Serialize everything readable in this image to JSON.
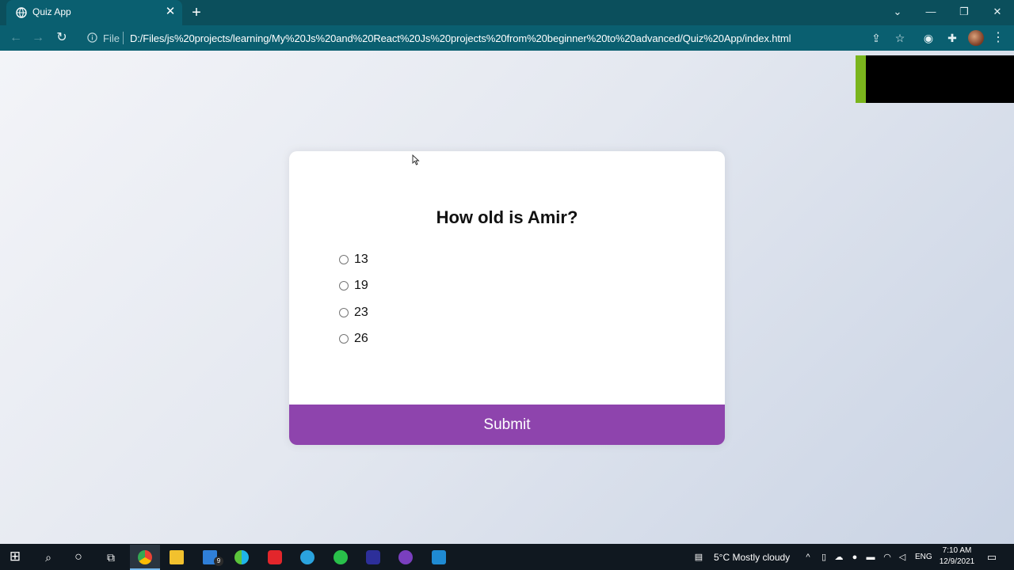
{
  "browser": {
    "tab_title": "Quiz App",
    "url_scheme": "File",
    "url": "D:/Files/js%20projects/learning/My%20Js%20and%20React%20Js%20projects%20from%20beginner%20to%20advanced/Quiz%20App/index.html"
  },
  "quiz": {
    "question": "How old is Amir?",
    "answers": [
      "13",
      "19",
      "23",
      "26"
    ],
    "submit_label": "Submit"
  },
  "taskbar": {
    "mail_badge": "9",
    "weather": "5°C  Mostly cloudy",
    "language": "ENG",
    "time": "7:10 AM",
    "date": "12/9/2021"
  },
  "colors": {
    "browser_frame": "#0b4f5c",
    "accent_button": "#8e44ad",
    "overlay_green": "#7ab51d"
  }
}
